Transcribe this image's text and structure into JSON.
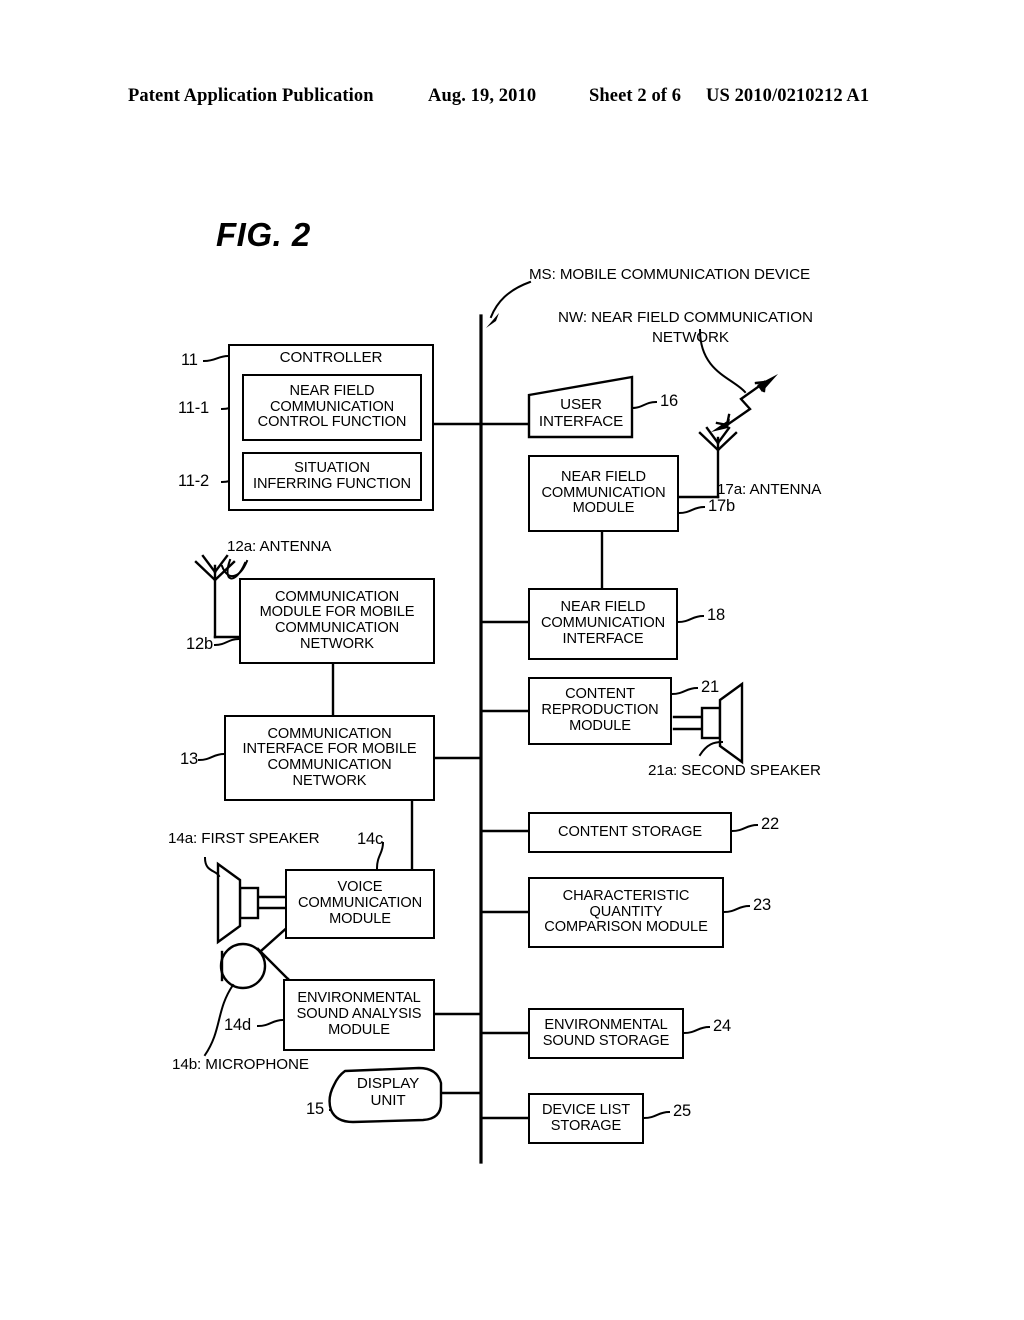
{
  "header": {
    "publication": "Patent Application Publication",
    "date": "Aug. 19, 2010",
    "sheet": "Sheet 2 of 6",
    "number": "US 2010/0210212 A1"
  },
  "figure": {
    "label": "FIG. 2"
  },
  "callouts": {
    "ms": "MS: MOBILE COMMUNICATION DEVICE",
    "nw_line1": "NW: NEAR FIELD COMMUNICATION",
    "nw_line2": "NETWORK",
    "antenna_12a": "12a: ANTENNA",
    "antenna_17a": "17a: ANTENNA",
    "speaker_21a": "21a: SECOND SPEAKER",
    "speaker_14a": "14a: FIRST SPEAKER",
    "microphone_14b": "14b: MICROPHONE"
  },
  "refs": {
    "r11": "11",
    "r11_1": "11-1",
    "r11_2": "11-2",
    "r12b": "12b",
    "r13": "13",
    "r14c": "14c",
    "r14d": "14d",
    "r15": "15",
    "r16": "16",
    "r17b": "17b",
    "r18": "18",
    "r21": "21",
    "r22": "22",
    "r23": "23",
    "r24": "24",
    "r25": "25"
  },
  "blocks": {
    "controller": "CONTROLLER",
    "nfc_control_function": "NEAR FIELD\nCOMMUNICATION\nCONTROL FUNCTION",
    "situation_inferring": "SITUATION\nINFERRING FUNCTION",
    "comm_module_mobile": "COMMUNICATION\nMODULE FOR MOBILE\nCOMMUNICATION\nNETWORK",
    "comm_interface_mobile": "COMMUNICATION\nINTERFACE FOR MOBILE\nCOMMUNICATION\nNETWORK",
    "voice_comm_module": "VOICE\nCOMMUNICATION\nMODULE",
    "env_sound_analysis": "ENVIRONMENTAL\nSOUND ANALYSIS\nMODULE",
    "display_unit": "DISPLAY\nUNIT",
    "user_interface": "USER\nINTERFACE",
    "nfc_module": "NEAR FIELD\nCOMMUNICATION\nMODULE",
    "nfc_interface": "NEAR FIELD\nCOMMUNICATION\nINTERFACE",
    "content_reproduction": "CONTENT\nREPRODUCTION\nMODULE",
    "content_storage": "CONTENT STORAGE",
    "characteristic_quantity": "CHARACTERISTIC\nQUANTITY\nCOMPARISON MODULE",
    "env_sound_storage": "ENVIRONMENTAL\nSOUND STORAGE",
    "device_list_storage": "DEVICE LIST\nSTORAGE"
  },
  "colors": {
    "ink": "#000000",
    "paper": "#ffffff"
  }
}
